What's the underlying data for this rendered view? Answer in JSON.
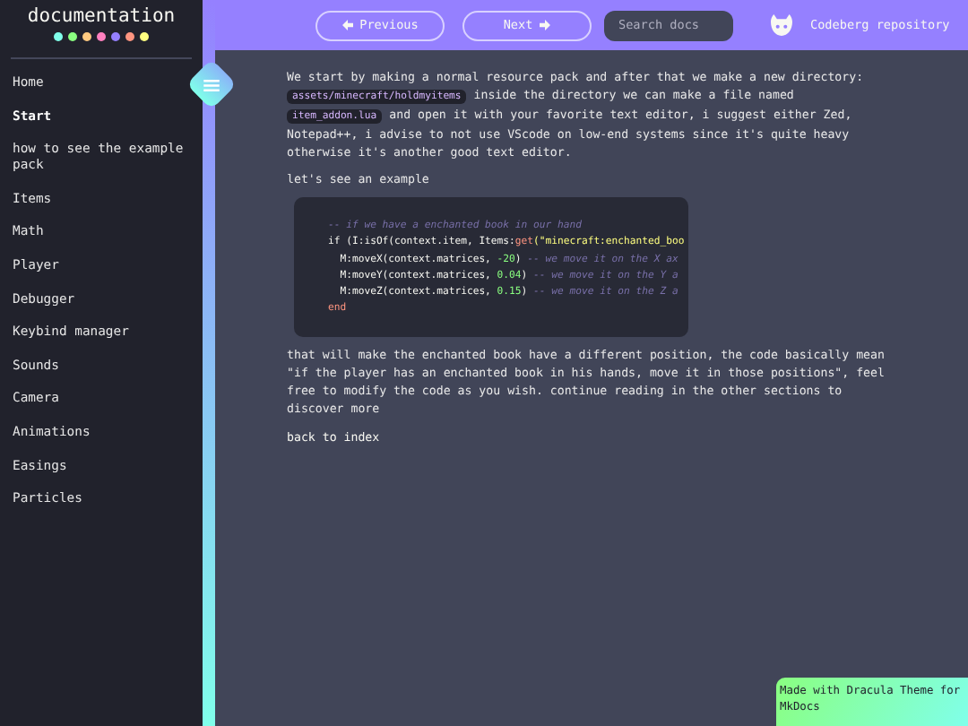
{
  "sidebar": {
    "title": "documentation",
    "dots": [
      {
        "color": "#80ffea"
      },
      {
        "color": "#8aff80"
      },
      {
        "color": "#ffca80"
      },
      {
        "color": "#ff80bf"
      },
      {
        "color": "#9580ff"
      },
      {
        "color": "#ff9580"
      },
      {
        "color": "#ffff80"
      }
    ],
    "items": [
      {
        "label": "Home",
        "selected": false
      },
      {
        "label": "Start",
        "selected": true
      },
      {
        "label": "how to see the example pack",
        "selected": false
      },
      {
        "label": "Items",
        "selected": false
      },
      {
        "label": "Math",
        "selected": false
      },
      {
        "label": "Player",
        "selected": false
      },
      {
        "label": "Debugger",
        "selected": false
      },
      {
        "label": "Keybind manager",
        "selected": false
      },
      {
        "label": "Sounds",
        "selected": false
      },
      {
        "label": "Camera",
        "selected": false
      },
      {
        "label": "Animations",
        "selected": false
      },
      {
        "label": "Easings",
        "selected": false
      },
      {
        "label": "Particles",
        "selected": false
      }
    ]
  },
  "topbar": {
    "previous": "Previous",
    "next": "Next",
    "search": {
      "placeholder": "Search docs"
    },
    "repo": "Codeberg repository"
  },
  "content": [
    {
      "kind": "paragraph",
      "parts": [
        {
          "kind": "text",
          "text": "We start by making a normal resource pack and after that we make a new directory: "
        },
        {
          "kind": "code",
          "text": "assets/minecraft/holdmyitems"
        },
        {
          "kind": "text",
          "text": " inside the directory we can make a file named "
        },
        {
          "kind": "code",
          "text": "item_addon.lua"
        },
        {
          "kind": "text",
          "text": " and open it with your favorite text editor, i suggest either Zed, Notepad++, i advise to not use VScode on low-end systems since it's quite heavy otherwise it's another good text editor."
        }
      ]
    },
    {
      "kind": "paragraph",
      "parts": [
        {
          "kind": "text",
          "text": "let's see an example"
        }
      ]
    },
    {
      "kind": "codeblock",
      "lines": [
        [
          {
            "kind": "comment",
            "text": "-- if we have a enchanted book in our hand"
          }
        ],
        [
          {
            "kind": "plain",
            "text": "if (I:isOf(context.item, Items:"
          },
          {
            "kind": "keyword",
            "text": "get"
          },
          {
            "kind": "string",
            "text": "(\"minecraft:enchanted_boo"
          }
        ],
        [
          {
            "kind": "plain",
            "text": "  M:moveX(context.matrices, "
          },
          {
            "kind": "number",
            "text": "-20"
          },
          {
            "kind": "plain",
            "text": ") "
          },
          {
            "kind": "comment",
            "text": "-- we move it on the X ax"
          }
        ],
        [
          {
            "kind": "plain",
            "text": "  M:moveY(context.matrices, "
          },
          {
            "kind": "number",
            "text": "0.04"
          },
          {
            "kind": "plain",
            "text": ") "
          },
          {
            "kind": "comment",
            "text": "-- we move it on the Y a"
          }
        ],
        [
          {
            "kind": "plain",
            "text": "  M:moveZ(context.matrices, "
          },
          {
            "kind": "number",
            "text": "0.15"
          },
          {
            "kind": "plain",
            "text": ") "
          },
          {
            "kind": "comment",
            "text": "-- we move it on the Z a"
          }
        ],
        [
          {
            "kind": "keyword",
            "text": "end"
          }
        ]
      ]
    },
    {
      "kind": "paragraph",
      "parts": [
        {
          "kind": "text",
          "text": "that will make the enchanted book have a different position, the code basically mean \"if the player has an enchanted book in his hands, move it in those positions\", feel free to modify the code as you wish. continue reading in the other sections to discover more"
        }
      ]
    },
    {
      "kind": "link",
      "text": "back to index"
    }
  ],
  "footer_badge": "Made with Dracula Theme for MkDocs"
}
